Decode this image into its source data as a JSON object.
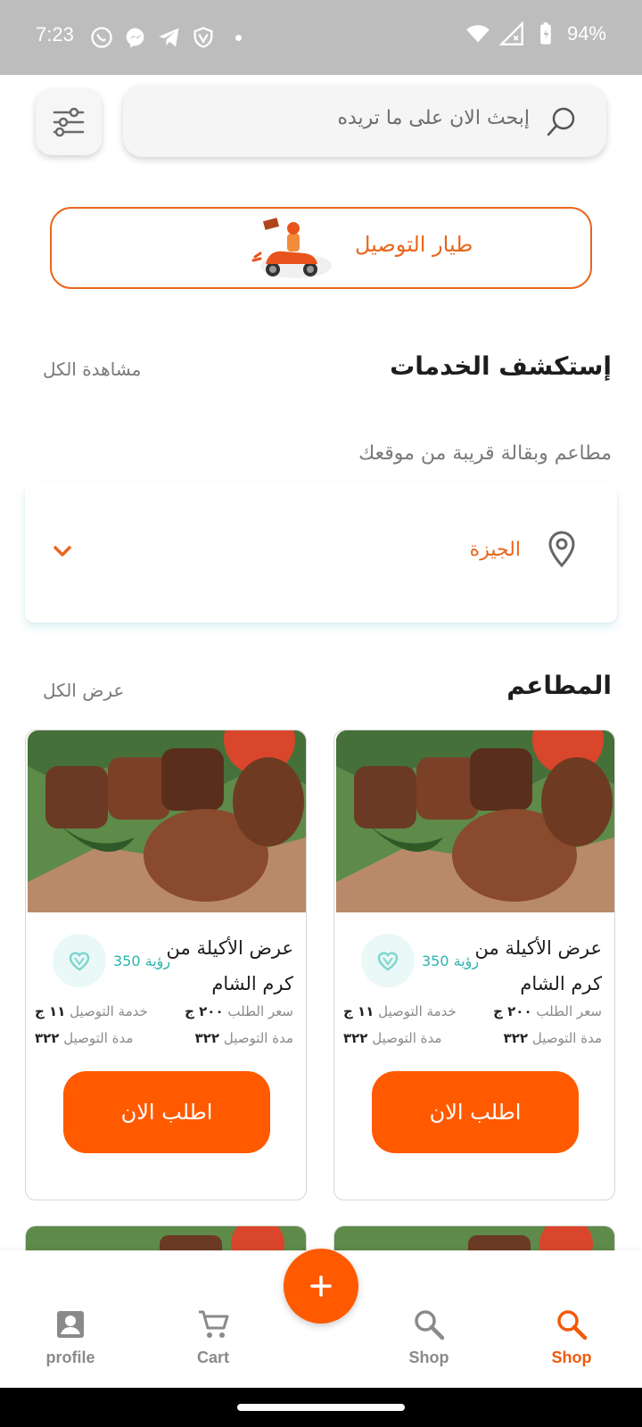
{
  "status_bar": {
    "time": "7:23",
    "battery": "94%"
  },
  "search": {
    "placeholder": "إبحث الان على ما تريده"
  },
  "delivery_banner": {
    "label": "طيار التوصيل"
  },
  "services": {
    "title": "إستكشف الخدمات",
    "see_all": "مشاهدة الكل",
    "subtitle": "مطاعم وبقالة قريبة من موقعك"
  },
  "location": {
    "name": "الجيزة"
  },
  "restaurants": {
    "title": "المطاعم",
    "see_all": "عرض الكل",
    "items": [
      {
        "title": "عرض الأكيلة من كرم الشام",
        "views": "350",
        "views_label": "رؤية",
        "order_price_label": "سعر الطلب",
        "order_price": "٢٠٠ ج",
        "delivery_service_label": "خدمة التوصيل",
        "delivery_service": "١١ ج",
        "delivery_time_label": "مدة التوصيل",
        "delivery_time": "٣٢٢",
        "button": "اطلب الان"
      },
      {
        "title": "عرض الأكيلة من كرم الشام",
        "views": "350",
        "views_label": "رؤية",
        "order_price_label": "سعر الطلب",
        "order_price": "٢٠٠ ج",
        "delivery_service_label": "خدمة التوصيل",
        "delivery_service": "١١ ج",
        "delivery_time_label": "مدة التوصيل",
        "delivery_time": "٣٢٢",
        "button": "اطلب الان"
      }
    ]
  },
  "bottom_nav": {
    "items": [
      {
        "label": "profile",
        "icon": "profile-icon"
      },
      {
        "label": "Cart",
        "icon": "cart-icon"
      },
      {
        "label": "Shop",
        "icon": "search-icon"
      },
      {
        "label": "Shop",
        "icon": "search-icon",
        "active": true
      }
    ],
    "fab_icon": "plus-icon"
  },
  "colors": {
    "accent": "#ff5a00",
    "accent_text": "#e8671c",
    "teal": "#2bb3ae"
  }
}
